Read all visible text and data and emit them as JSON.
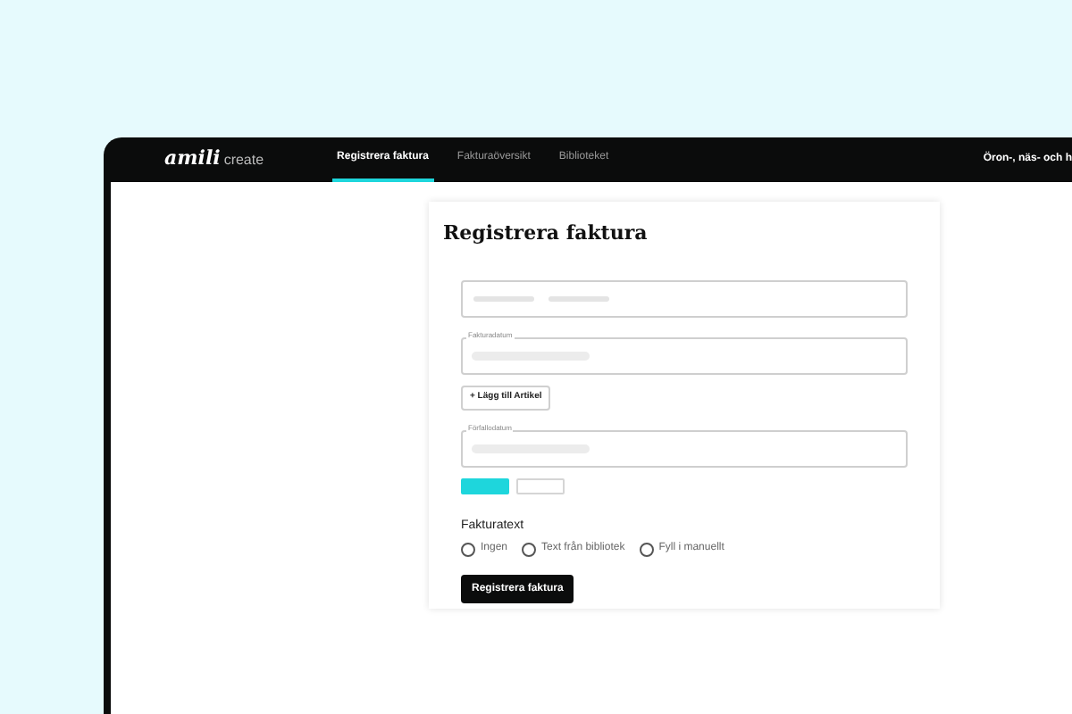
{
  "nav": {
    "logo": {
      "brand": "amili",
      "product": "create"
    },
    "tabs": [
      {
        "label": "Registrera faktura",
        "selected": true
      },
      {
        "label": "Fakturaöversikt",
        "selected": false
      },
      {
        "label": "Biblioteket",
        "selected": false
      }
    ],
    "right_label": "Öron-, näs- och h"
  },
  "form": {
    "title": "Registrera faktura",
    "fields": [
      {
        "kind": "double"
      },
      {
        "kind": "single",
        "label": "Fakturadatum"
      },
      {
        "kind": "button",
        "label": "Lägg till Artikel",
        "icon": "+"
      },
      {
        "kind": "single",
        "label": "Förfallodatum"
      }
    ],
    "swatches": [
      {
        "color": "#1ed6dc"
      },
      {
        "color": "#ffffff"
      }
    ],
    "radio_group": {
      "label": "Fakturatext",
      "options": [
        {
          "label": "Ingen",
          "selected": false
        },
        {
          "label": "Text från bibliotek",
          "selected": false
        },
        {
          "label": "Fyll i manuellt",
          "selected": false
        }
      ]
    },
    "submit": "Registrera faktura"
  }
}
